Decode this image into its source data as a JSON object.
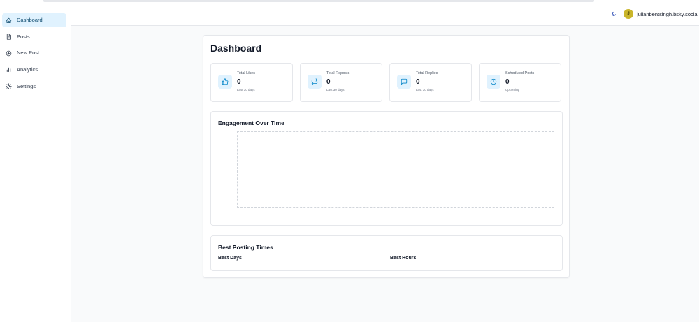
{
  "sidebar": {
    "items": [
      {
        "label": "Dashboard",
        "icon": "home-icon",
        "active": true
      },
      {
        "label": "Posts",
        "icon": "document-icon"
      },
      {
        "label": "New Post",
        "icon": "plus-circle-icon"
      },
      {
        "label": "Analytics",
        "icon": "bar-chart-icon"
      },
      {
        "label": "Settings",
        "icon": "gear-icon"
      }
    ]
  },
  "header": {
    "theme_icon": "moon-icon",
    "avatar_initial": "J",
    "username": "julianbentsingh.bsky.social"
  },
  "main": {
    "title": "Dashboard",
    "stats": [
      {
        "label": "Total Likes",
        "value": "0",
        "sub": "Last 30 days",
        "icon": "thumbs-up-icon"
      },
      {
        "label": "Total Reposts",
        "value": "0",
        "sub": "Last 30 days",
        "icon": "repost-icon"
      },
      {
        "label": "Total Replies",
        "value": "0",
        "sub": "Last 30 days",
        "icon": "chat-bubble-icon"
      },
      {
        "label": "Scheduled Posts",
        "value": "0",
        "sub": "Upcoming",
        "icon": "clock-icon"
      }
    ],
    "engagement": {
      "title": "Engagement Over Time"
    },
    "best_times": {
      "title": "Best Posting Times",
      "days_label": "Best Days",
      "hours_label": "Best Hours"
    }
  },
  "colors": {
    "accent": "#0284c7",
    "active_bg": "#e0f2fe",
    "avatar": "#c9b52a"
  }
}
